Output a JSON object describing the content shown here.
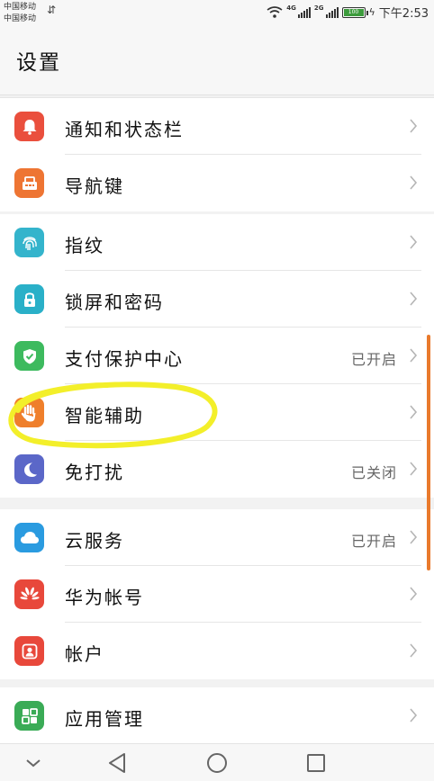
{
  "status_bar": {
    "carrier_1": "中国移动",
    "carrier_2": "中国移动",
    "network_1": "4G",
    "network_2": "2G",
    "battery_level": "100",
    "time": "下午2:53"
  },
  "header": {
    "title": "设置"
  },
  "groups": [
    {
      "items": [
        {
          "label": "通知和状态栏",
          "status": "",
          "icon": "bell-icon",
          "color": "#ea4f3d"
        },
        {
          "label": "导航键",
          "status": "",
          "icon": "navigation-key-icon",
          "color": "#ee7533"
        }
      ]
    },
    {
      "items": [
        {
          "label": "指纹",
          "status": "",
          "icon": "fingerprint-icon",
          "color": "#34b4cc"
        },
        {
          "label": "锁屏和密码",
          "status": "",
          "icon": "lock-icon",
          "color": "#2ab0c8"
        },
        {
          "label": "支付保护中心",
          "status": "已开启",
          "icon": "shield-check-icon",
          "color": "#3dba5e"
        },
        {
          "label": "智能辅助",
          "status": "",
          "icon": "hand-icon",
          "color": "#ef7f2b"
        },
        {
          "label": "免打扰",
          "status": "已关闭",
          "icon": "moon-icon",
          "color": "#5b67c8"
        }
      ]
    },
    {
      "items": [
        {
          "label": "云服务",
          "status": "已开启",
          "icon": "cloud-icon",
          "color": "#2a9be0"
        },
        {
          "label": "华为帐号",
          "status": "",
          "icon": "huawei-logo-icon",
          "color": "#e8483b"
        },
        {
          "label": "帐户",
          "status": "",
          "icon": "account-icon",
          "color": "#e8483b"
        }
      ]
    },
    {
      "items": [
        {
          "label": "应用管理",
          "status": "",
          "icon": "apps-grid-icon",
          "color": "#3aab56"
        }
      ]
    }
  ],
  "nav_bar": {
    "buttons": [
      "hide-nav-button",
      "back-button",
      "home-button",
      "recents-button"
    ]
  }
}
